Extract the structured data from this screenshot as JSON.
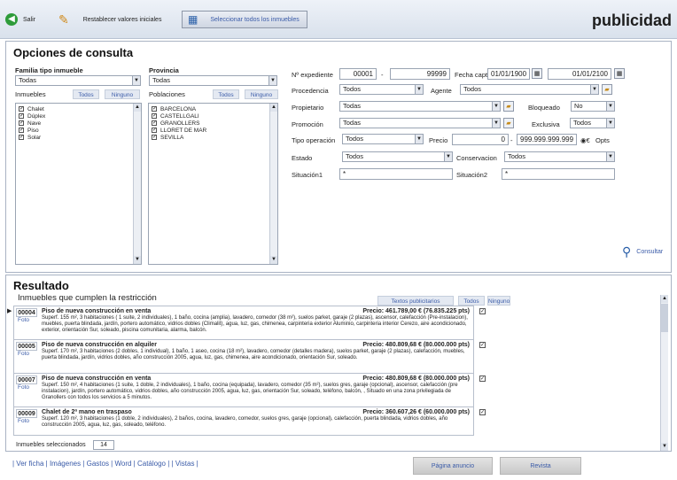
{
  "app": {
    "title": "publicidad"
  },
  "toolbar": {
    "exit": "Salir",
    "reset": "Restablecer valores iniciales",
    "select_all": "Seleccionar todos los inmuebles"
  },
  "options": {
    "title": "Opciones de consulta",
    "family_label": "Familia tipo inmueble",
    "family_value": "Todas",
    "province_label": "Provincia",
    "province_value": "Todas",
    "inmuebles_label": "Inmuebles",
    "poblaciones_label": "Poblaciones",
    "todos": "Todos",
    "ninguno": "Ninguno",
    "inmuebles": [
      "Chalet",
      "Dúplex",
      "Nave",
      "Piso",
      "Solar"
    ],
    "poblaciones": [
      "BARCELONA",
      "CASTELLGALI",
      "GRANOLLERS",
      "LLORET DE MAR",
      "SEVILLA"
    ]
  },
  "form": {
    "expediente_label": "Nº expediente",
    "expediente_from": "00001",
    "dash": "-",
    "expediente_to": "99999",
    "fecha_label": "Fecha captación",
    "fecha_from": "01/01/1900",
    "fecha_to": "01/01/2100",
    "procedencia_label": "Procedencia",
    "procedencia_value": "Todos",
    "agente_label": "Agente",
    "agente_value": "Todos",
    "propietario_label": "Propietario",
    "propietario_value": "Todas",
    "bloqueado_label": "Bloqueado",
    "bloqueado_value": "No",
    "promocion_label": "Promoción",
    "promocion_value": "Todas",
    "exclusiva_label": "Exclusiva",
    "exclusiva_value": "Todos",
    "tipo_label": "Tipo operación",
    "tipo_value": "Todos",
    "precio_label": "Precio",
    "precio_from": "0",
    "precio_to": "999.999.999.999",
    "currency_opt": "€",
    "pts_opt": "Opts",
    "estado_label": "Estado",
    "estado_value": "Todos",
    "conservacion_label": "Conservacion",
    "conservacion_value": "Todos",
    "situacion1_label": "Situación1",
    "situacion1_value": "*",
    "situacion2_label": "Situación2",
    "situacion2_value": "*",
    "consultar": "Consultar"
  },
  "results": {
    "title": "Resultado",
    "subtitle": "Inmuebles que cumplen la restricción",
    "textos_btn": "Textos publicitarios",
    "todos_btn": "Todos",
    "ninguno_btn": "Ninguno",
    "foto": "Foto",
    "records": [
      {
        "code": "00004",
        "title": "Piso de nueva construcción en venta",
        "price": "Precio: 461.789,00 € (76.835.225 pts)",
        "desc": "Superf. 155 m², 3 habitaciones ( 1 suite, 2 individuales), 1 baño, cocina (amplia), lavadero, comedor (38 m²), suelos parket, garaje (2 plazas), ascensor, calefacción (Pre-instalacion), muebles, puerta blindada, jardín, portero automático, vidrios dobles (Climalit), agua, luz, gas, chimenea, carpinteria exterior Aluminio, carpinteria interior Cerezo, aire acondicionado, exterior, orientación Sur, soleado, piscina comunitaria, alarma, balcón."
      },
      {
        "code": "00005",
        "title": "Piso de nueva construcción en alquiler",
        "price": "Precio: 480.809,68 € (80.000.000 pts)",
        "desc": "Superf. 170 m², 3 habitaciones (2 dobles, 1 individual), 1 baño, 1 aseo, cocina (18 m²), lavadero, comedor (detalles madera), suelos parket, garaje (2 plazas), calefacción, muebles, puerta blindada, jardín, vidrios dobles, año construcción 2005, agua, luz, gas, chimenea, aire acondicionado, orientación Sur, soleado."
      },
      {
        "code": "00007",
        "title": "Piso de nueva construcción en venta",
        "price": "Precio: 480.809,68 € (80.000.000 pts)",
        "desc": "Superf. 150 m², 4 habitaciones (1 suite, 1 doble, 2 individuales), 1 baño, cocina (equipada), lavadero, comedor (35 m²), suelos gres, garaje (opcional), ascensor, calefacción (pre instalacion), jardín, portero automático, vidrios dobles, año construcción 2005, agua, luz, gas, orientación Sur, soleado, teléfono, balcón, , Situado en una zona privilegiada de Granollers con todos los servicios a 5 minutos."
      },
      {
        "code": "00009",
        "title": "Chalet de 2ª mano en traspaso",
        "price": "Precio: 360.607,26 € (60.000.000 pts)",
        "desc": "Superf. 120 m², 3 habitaciones (1 doble, 2 individuales), 2 baños, cocina, lavadero, comedor, suelos gres, garaje (opcional), calefacción, puerta blindada, vidrios dobles, año construcción 2005, agua, luz, gas, soleado, teléfono."
      }
    ],
    "selected_label": "Inmuebles seleccionados",
    "selected_count": "14"
  },
  "footer": {
    "links": "| Ver ficha | Imágenes | Gastos | Word | Catálogo | | Vistas |",
    "pagina": "Página anuncio",
    "revista": "Revista"
  },
  "colors": {
    "toolbar_top": "#eef2f8",
    "accent_link": "#3a5ba8"
  }
}
